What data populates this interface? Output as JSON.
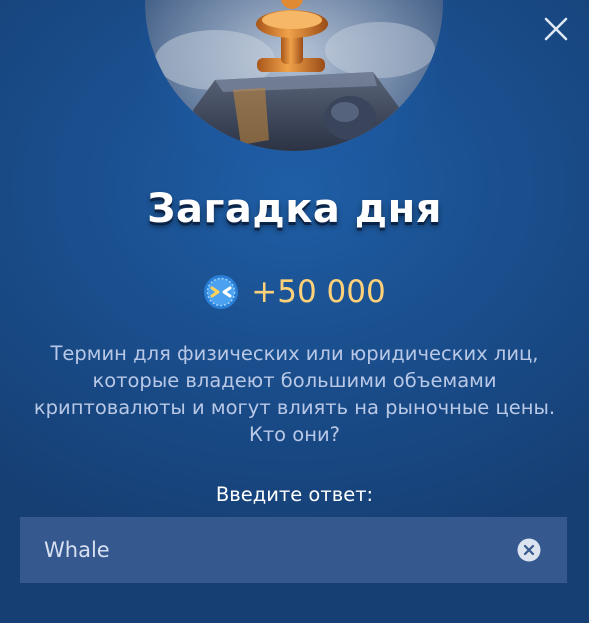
{
  "header": {
    "hero_icon": "treasure-chest-illustration",
    "close_icon": "close-icon"
  },
  "riddle": {
    "title": "Загадка дня",
    "reward": {
      "icon": "coin-icon",
      "amount": "+50 000"
    },
    "question": "Термин для физических или юридических лиц, которые владеют большими объемами криптовалюты и могут влиять на рыночные цены. Кто они?"
  },
  "answer": {
    "label": "Введите ответ:",
    "value": "Whale",
    "placeholder": "",
    "clear_icon": "clear-icon"
  },
  "colors": {
    "background": "#1a4f8e",
    "input_bg": "#35588f",
    "reward": "#ffd27a",
    "question_text": "#b9c8e6"
  }
}
